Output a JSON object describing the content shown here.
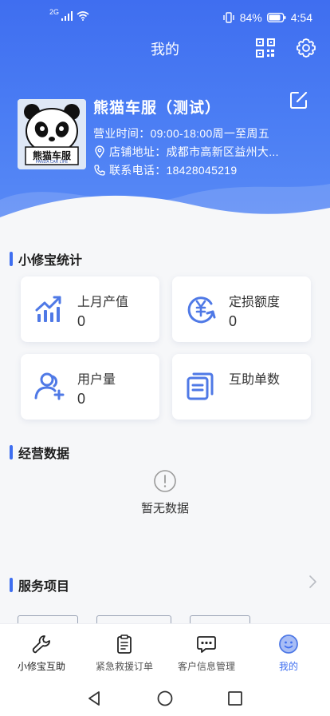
{
  "status_bar": {
    "network": "2G",
    "battery": "84%",
    "time": "4:54"
  },
  "header": {
    "title": "我的"
  },
  "shop": {
    "name": "熊猫车服（测试）",
    "hours": "营业时间：09:00-18:00周一至周五",
    "address": "店铺地址：成都市高新区益州大...",
    "phone": "联系电话：18428045219",
    "logo_text": "熊猫车服",
    "logo_subtext": "PANDA CAR LIFE"
  },
  "stats": {
    "title": "小修宝统计",
    "cards": [
      {
        "label": "上月产值",
        "value": "0",
        "icon": "chart-up-icon"
      },
      {
        "label": "定损额度",
        "value": "0",
        "icon": "yuan-cycle-icon"
      },
      {
        "label": "用户量",
        "value": "0",
        "icon": "user-add-icon"
      },
      {
        "label": "互助单数",
        "value": "",
        "icon": "documents-icon"
      }
    ]
  },
  "operations": {
    "title": "经营数据",
    "empty_text": "暂无数据"
  },
  "services": {
    "title": "服务项目"
  },
  "tabbar": {
    "items": [
      {
        "label": "小修宝互助",
        "icon": "wrench-icon",
        "active": false
      },
      {
        "label": "紧急救援订单",
        "icon": "clipboard-icon",
        "active": false
      },
      {
        "label": "客户信息管理",
        "icon": "chat-icon",
        "active": false
      },
      {
        "label": "我的",
        "icon": "smile-icon",
        "active": true
      }
    ]
  },
  "colors": {
    "primary": "#3e6ef0",
    "icon_blue": "#4f79e6",
    "text_dark": "#222222",
    "text_gray": "#555555"
  }
}
